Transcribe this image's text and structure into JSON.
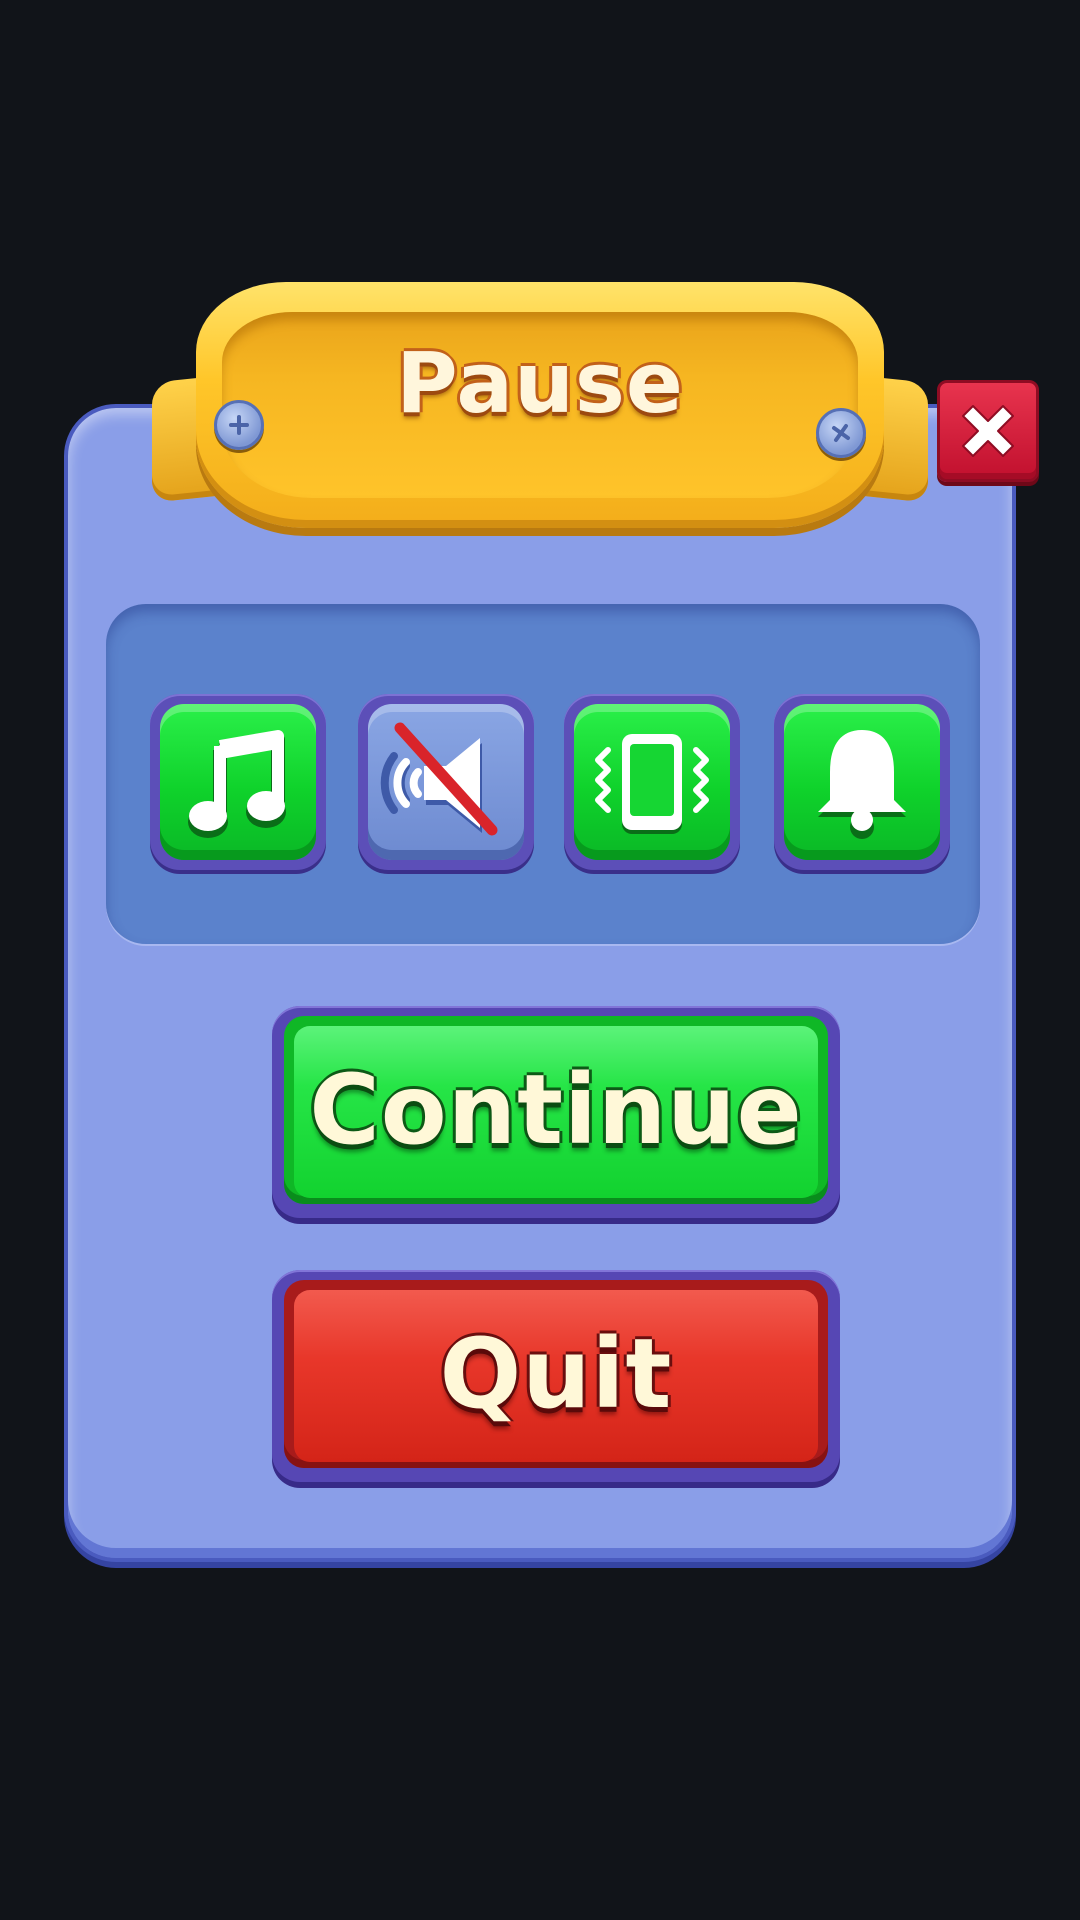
{
  "dialog": {
    "title": "Pause",
    "close_icon": "close-x-icon",
    "colors": {
      "panel": "#8a9ee8",
      "banner": "#ffc629",
      "close": "#d41f3b",
      "toggle_on": "#12d22f",
      "toggle_off": "#6d8ad0"
    }
  },
  "settings": {
    "toggles": [
      {
        "name": "music",
        "icon": "music-note-icon",
        "enabled": true
      },
      {
        "name": "sound",
        "icon": "speaker-muted-icon",
        "enabled": false
      },
      {
        "name": "vibration",
        "icon": "phone-vibrate-icon",
        "enabled": true
      },
      {
        "name": "notifications",
        "icon": "bell-icon",
        "enabled": true
      }
    ]
  },
  "actions": {
    "continue_label": "Continue",
    "quit_label": "Quit"
  }
}
